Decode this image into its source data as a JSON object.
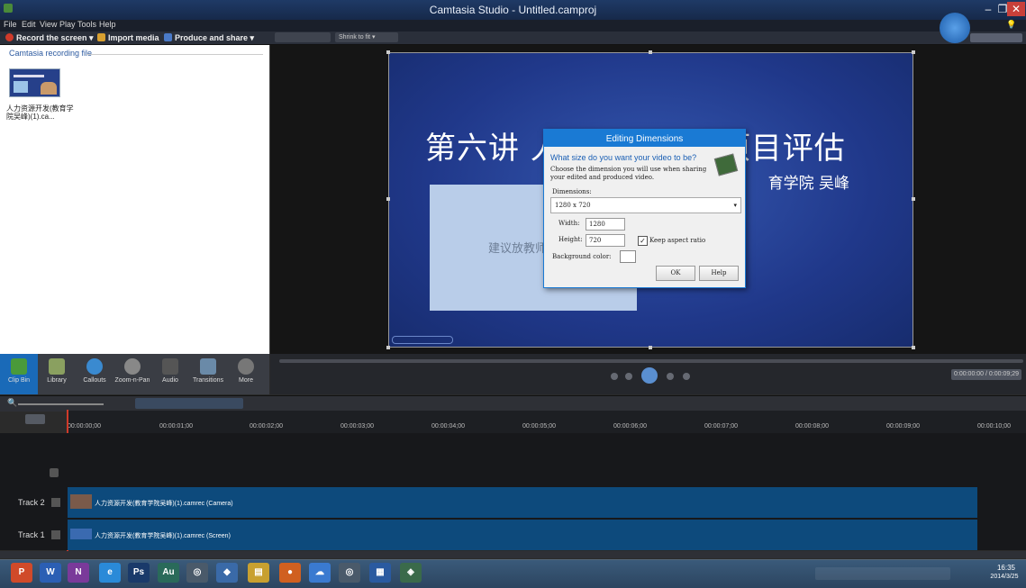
{
  "window": {
    "title": "Camtasia Studio - Untitled.camproj",
    "min": "–",
    "max": "❐",
    "close": "✕"
  },
  "menu": [
    "File",
    "Edit",
    "View",
    "Play",
    "Tools",
    "Help"
  ],
  "toolbar": {
    "record": "Record the screen ▾",
    "import": "Import media",
    "produce": "Produce and share ▾",
    "shrink": "Shrink to fit ▾"
  },
  "clipbin": {
    "header": "Camtasia recording file",
    "clip_label": "人力资源开发(教育学院吴峰)(1).ca..."
  },
  "slide": {
    "title": "第六讲 人力资源开发项目评估",
    "subtitle": "育学院  吴峰",
    "placeholder": "建议放教师"
  },
  "dialog": {
    "title": "Editing Dimensions",
    "question": "What size do you want your video to be?",
    "description": "Choose the dimension you will use when sharing your edited and produced video.",
    "dimensions_label": "Dimensions:",
    "dimensions_value": "1280 x 720",
    "width_label": "Width:",
    "width_value": "1280",
    "height_label": "Height:",
    "height_value": "720",
    "keep_aspect": "Keep aspect ratio",
    "keep_aspect_checked": true,
    "bg_label": "Background color:",
    "ok": "OK",
    "help": "Help"
  },
  "tabs": [
    {
      "label": "Clip Bin",
      "color": "#4a9a3a"
    },
    {
      "label": "Library",
      "color": "#8aa060"
    },
    {
      "label": "Callouts",
      "color": "#3a8ad0"
    },
    {
      "label": "Zoom-n-Pan",
      "color": "#888888"
    },
    {
      "label": "Audio",
      "color": "#555555"
    },
    {
      "label": "Transitions",
      "color": "#6a8aa8"
    },
    {
      "label": "More",
      "color": "#777777"
    }
  ],
  "playback": {
    "timecode": "0:00:00:00 / 0:00:09;29"
  },
  "ruler": [
    "00:00:00;00",
    "00:00:01;00",
    "00:00:02;00",
    "00:00:03;00",
    "00:00:04;00",
    "00:00:05;00",
    "00:00:06;00",
    "00:00:07;00",
    "00:00:08;00",
    "00:00:09;00",
    "00:00:10;00"
  ],
  "tracks": [
    {
      "label": "Track 2",
      "clip": "人力资源开发(教育学院吴峰)(1).camrec (Camera)"
    },
    {
      "label": "Track 1",
      "clip": "人力资源开发(教育学院吴峰)(1).camrec (Screen)"
    }
  ],
  "taskbar": {
    "apps": [
      {
        "label": "P",
        "name": "powerpoint",
        "color": "#d04a2a"
      },
      {
        "label": "W",
        "name": "word",
        "color": "#2b5fb4"
      },
      {
        "label": "N",
        "name": "onenote",
        "color": "#7a3a9a"
      },
      {
        "label": "e",
        "name": "internet-explorer",
        "color": "#2a8ad8"
      },
      {
        "label": "Ps",
        "name": "photoshop",
        "color": "#1a3a6a"
      },
      {
        "label": "Au",
        "name": "audition",
        "color": "#2a6a5a"
      },
      {
        "label": "◎",
        "name": "disc",
        "color": "#4a5a6a"
      },
      {
        "label": "◆",
        "name": "python",
        "color": "#3a6aa8"
      },
      {
        "label": "▤",
        "name": "file-explorer",
        "color": "#c8a030"
      },
      {
        "label": "●",
        "name": "firefox",
        "color": "#d06020"
      },
      {
        "label": "☁",
        "name": "network",
        "color": "#3a7ad0"
      },
      {
        "label": "◎",
        "name": "media",
        "color": "#4a5a6a"
      },
      {
        "label": "▦",
        "name": "camtasia-recorder",
        "color": "#2a5aa0"
      },
      {
        "label": "◈",
        "name": "camtasia-studio",
        "color": "#3a6a4a"
      }
    ],
    "time": "16:35",
    "date": "2014/3/25"
  }
}
